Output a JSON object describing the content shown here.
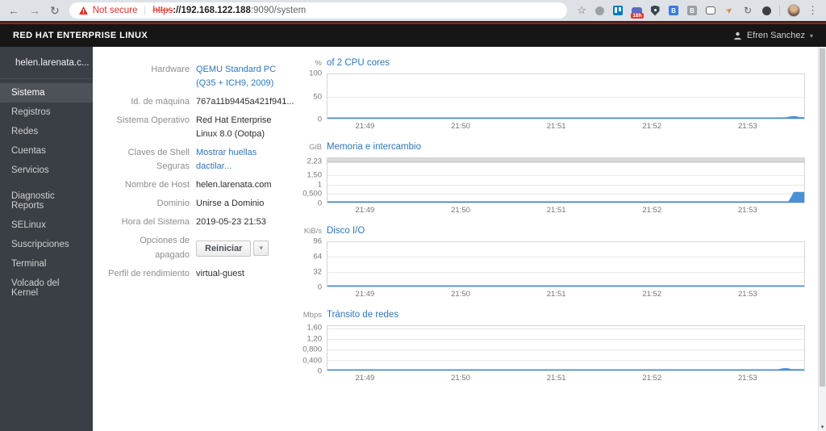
{
  "browser": {
    "security_warning": "Not secure",
    "url_scheme": "https",
    "url_host": "://192.168.122.188",
    "url_path": ":9090/system",
    "extension_badge": "18h"
  },
  "masthead": {
    "brand": "RED HAT ENTERPRISE LINUX",
    "user_name": "Efren Sanchez"
  },
  "sidebar": {
    "host_label": "helen.larenata.c...",
    "items": [
      {
        "id": "sistema",
        "label": "Sistema",
        "active": true
      },
      {
        "id": "registros",
        "label": "Registros"
      },
      {
        "id": "redes",
        "label": "Redes"
      },
      {
        "id": "cuentas",
        "label": "Cuentas"
      },
      {
        "id": "servicios",
        "label": "Servicios"
      },
      {
        "id": "diagnostic-reports",
        "label": "Diagnostic Reports",
        "gap_before": true
      },
      {
        "id": "selinux",
        "label": "SELinux"
      },
      {
        "id": "suscripciones",
        "label": "Suscripciones"
      },
      {
        "id": "terminal",
        "label": "Terminal"
      },
      {
        "id": "volcado-del-kernel",
        "label": "Volcado del Kernel"
      }
    ]
  },
  "system": {
    "fields": [
      {
        "id": "hardware",
        "label": "Hardware",
        "value": "QEMU Standard PC (Q35 + ICH9, 2009)",
        "type": "link"
      },
      {
        "id": "machine-id",
        "label": "Id. de máquina",
        "value": "767a11b9445a421f941...",
        "type": "text"
      },
      {
        "id": "operating-system",
        "label": "Sistema Operativo",
        "value": "Red Hat Enterprise Linux 8.0 (Ootpa)",
        "type": "text"
      },
      {
        "id": "secure-shell-keys",
        "label": "Claves de Shell Seguras",
        "value": "Mostrar huellas dactilar...",
        "type": "link"
      },
      {
        "id": "hostname",
        "label": "Nombre de Host",
        "value": "helen.larenata.com",
        "type": "text"
      },
      {
        "id": "domain",
        "label": "Dominio",
        "value": "Unirse a Dominio",
        "type": "action"
      },
      {
        "id": "system-time",
        "label": "Hora del Sistema",
        "value": "2019-05-23 21:53",
        "type": "action"
      },
      {
        "id": "power-options",
        "label": "Opciones de apagado",
        "value": "Reiniciar",
        "type": "button"
      },
      {
        "id": "performance-profile",
        "label": "Perfil de rendimiento",
        "value": "virtual-guest",
        "type": "action"
      }
    ]
  },
  "chart_data": [
    {
      "id": "cpu",
      "type": "line",
      "title": "of 2 CPU cores",
      "unit": "%",
      "ymax": 100,
      "grid": true,
      "legend_position": "none",
      "y_ticks": [
        {
          "label": "100",
          "value": 100
        },
        {
          "label": "50",
          "value": 50
        },
        {
          "label": "0",
          "value": 0
        }
      ],
      "x_ticks": [
        "21:49",
        "21:50",
        "21:51",
        "21:52",
        "21:53"
      ],
      "series": [
        {
          "name": "cpu-usage-percent",
          "color": "#4a90d9",
          "points": [
            [
              0,
              1.2
            ],
            [
              0.94,
              1.2
            ],
            [
              0.962,
              1.5
            ],
            [
              0.972,
              3.5
            ],
            [
              0.982,
              4
            ],
            [
              0.99,
              2
            ],
            [
              1,
              1.5
            ]
          ]
        }
      ]
    },
    {
      "id": "memory",
      "type": "area",
      "title": "Memoria e intercambio",
      "unit": "GiB",
      "ymax": 2.45,
      "grid": true,
      "legend_position": "none",
      "top_band": {
        "from": 2.23,
        "label": "total-memory-cap"
      },
      "y_ticks": [
        {
          "label": "2,23",
          "value": 2.23
        },
        {
          "label": "1,50",
          "value": 1.5
        },
        {
          "label": "1",
          "value": 1
        },
        {
          "label": "0,500",
          "value": 0.5
        },
        {
          "label": "0",
          "value": 0
        }
      ],
      "x_ticks": [
        "21:49",
        "21:50",
        "21:51",
        "21:52",
        "21:53"
      ],
      "series": [
        {
          "name": "memory-used-gib",
          "color": "#4a90d9",
          "points": [
            [
              0,
              0.035
            ],
            [
              0.968,
              0.035
            ],
            [
              0.974,
              0.3
            ],
            [
              0.979,
              0.55
            ],
            [
              1,
              0.55
            ]
          ]
        }
      ]
    },
    {
      "id": "disk",
      "type": "line",
      "title": "Disco I/O",
      "unit": "KiB/s",
      "ymax": 96,
      "grid": true,
      "legend_position": "none",
      "y_ticks": [
        {
          "label": "96",
          "value": 96
        },
        {
          "label": "64",
          "value": 64
        },
        {
          "label": "32",
          "value": 32
        },
        {
          "label": "0",
          "value": 0
        }
      ],
      "x_ticks": [
        "21:49",
        "21:50",
        "21:51",
        "21:52",
        "21:53"
      ],
      "series": [
        {
          "name": "disk-io-kibps",
          "color": "#4a90d9",
          "points": [
            [
              0,
              1.1
            ],
            [
              1,
              1.1
            ]
          ]
        }
      ]
    },
    {
      "id": "network",
      "type": "line",
      "title": "Tránsito de redes",
      "unit": "Mbps",
      "ymax": 1.7,
      "grid": true,
      "legend_position": "none",
      "y_ticks": [
        {
          "label": "1,60",
          "value": 1.6
        },
        {
          "label": "1,20",
          "value": 1.2
        },
        {
          "label": "0,800",
          "value": 0.8
        },
        {
          "label": "0,400",
          "value": 0.4
        },
        {
          "label": "0",
          "value": 0
        }
      ],
      "x_ticks": [
        "21:49",
        "21:50",
        "21:51",
        "21:52",
        "21:53"
      ],
      "series": [
        {
          "name": "network-traffic-mbps",
          "color": "#4a90d9",
          "points": [
            [
              0,
              0.02
            ],
            [
              0.945,
              0.02
            ],
            [
              0.955,
              0.055
            ],
            [
              0.963,
              0.065
            ],
            [
              0.972,
              0.03
            ],
            [
              1,
              0.022
            ]
          ]
        }
      ]
    }
  ],
  "colors": {
    "accent_link": "#2b77bd",
    "series_blue": "#4a90d9",
    "masthead_bg": "#161616",
    "sidebar_bg": "#393f45",
    "sidebar_active_bg": "#4d5258",
    "warning_red": "#d93025"
  }
}
